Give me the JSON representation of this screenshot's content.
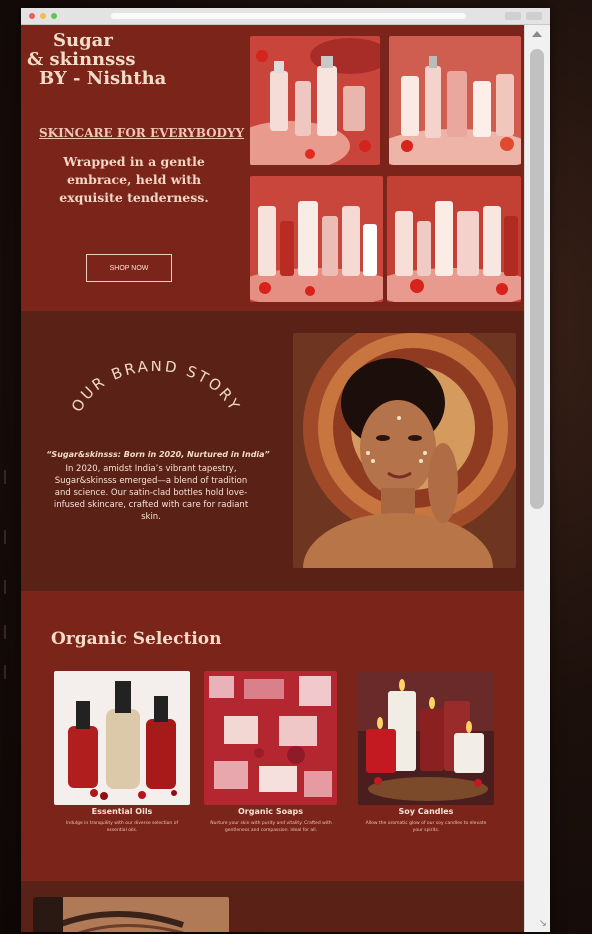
{
  "hero": {
    "brand_line1": "Sugar",
    "brand_line2": "& skinnsss",
    "brand_line3": "BY - Nishtha",
    "tagline": "SKINCARE FOR EVERYBODYY",
    "subtitle": "Wrapped in a gentle embrace, held with exquisite tenderness.",
    "shop_button": "SHOP NOW"
  },
  "story": {
    "heading": "OUR BRAND STORY",
    "title": "“Sugar&skinsss: Born in 2020, Nurtured in India”",
    "body": "In 2020, amidst India’s vibrant tapestry, Sugar&skinsss emerged—a blend of tradition and science. Our satin-clad bottles hold love-infused skincare, crafted with care for radiant skin."
  },
  "organic": {
    "title": "Organic Selection",
    "items": [
      {
        "name": "Essential Oils",
        "desc": "Indulge in tranquility with our diverse selection of essential oils."
      },
      {
        "name": "Organic Soaps",
        "desc": "Nurture your skin with purity and vitality. Crafted with gentleness and compassion. Ideal for all."
      },
      {
        "name": "Soy Candles",
        "desc": "Allow the aromatic glow of our soy candles to elevate your spirits."
      }
    ]
  },
  "colors": {
    "hero_bg": "#7b2419",
    "story_bg": "#5a2116",
    "text_cream": "#f2dcc8"
  },
  "icons": {
    "scroll_up": "chevron-up-icon",
    "resize": "resize-grip-icon"
  }
}
